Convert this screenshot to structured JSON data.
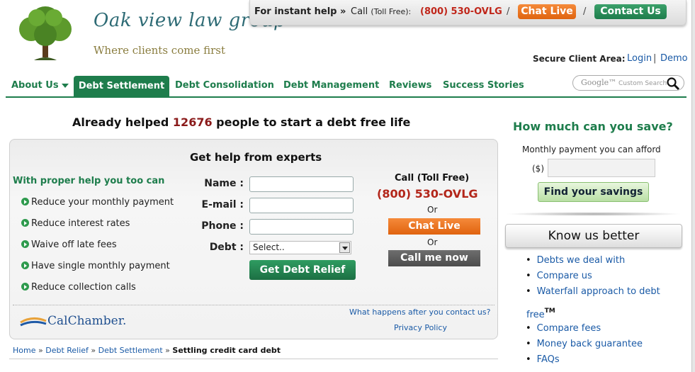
{
  "brand": {
    "title": "Oak view law group",
    "tagline": "Where clients come first",
    "colors": {
      "green": "#1e7d4c",
      "orange": "#e0630f",
      "red": "#c0261a",
      "link": "#1a5aa6"
    }
  },
  "helpbar": {
    "instant": "For instant help »",
    "call": "Call",
    "toll_free": "(Toll Free):",
    "phone": "(800) 530-OVLG",
    "slash": "/",
    "chat": "Chat Live",
    "contact": "Contact Us"
  },
  "secure": {
    "label": "Secure Client Area:",
    "login": "Login",
    "sep": "|",
    "demo": "Demo"
  },
  "nav": {
    "about": "About Us",
    "debt_settlement": "Debt Settlement",
    "debt_consolidation": "Debt Consolidation",
    "debt_management": "Debt Management",
    "reviews": "Reviews",
    "success": "Success Stories"
  },
  "search": {
    "google": "Google™",
    "placeholder": "Custom Search",
    "icon": "search-icon"
  },
  "headline": {
    "before": "Already helped",
    "count": "12676",
    "after": "people to start a debt free life"
  },
  "form": {
    "title": "Get help from experts",
    "with_help": "With proper help you too can",
    "benefits": [
      "Reduce your monthly payment",
      "Reduce interest rates",
      "Waive off late fees",
      "Have single monthly payment",
      "Reduce collection calls"
    ],
    "name_label": "Name :",
    "email_label": "E-mail :",
    "phone_label": "Phone :",
    "debt_label": "Debt :",
    "debt_selected": "Select..",
    "submit": "Get Debt Relief",
    "call_free": "Call (Toll Free)",
    "phone": "(800) 530-OVLG",
    "or1": "Or",
    "chat": "Chat Live",
    "or2": "Or",
    "call_now": "Call me now",
    "partner": "CalChamber.",
    "what_happens": "What happens after you contact us?",
    "privacy": "Privacy Policy"
  },
  "breadcrumb": {
    "home": "Home",
    "relief": "Debt Relief",
    "settlement": "Debt Settlement",
    "sep": "»",
    "current": "Settling credit card debt"
  },
  "savings": {
    "title": "How much can you save?",
    "label": "Monthly payment you can afford",
    "dollar": "($)",
    "button": "Find your savings"
  },
  "know": {
    "title": "Know us better",
    "items": [
      "Debts we deal with",
      "Compare us",
      "Waterfall approach to debt",
      "Compare fees",
      "Money back guarantee",
      "FAQs"
    ],
    "cont": "free",
    "tm": "TM"
  }
}
